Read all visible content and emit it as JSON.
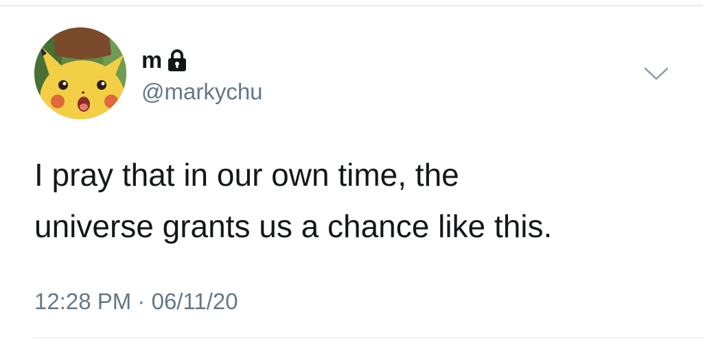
{
  "tweet": {
    "author": {
      "display_name": "m",
      "handle": "@markychu",
      "protected": true,
      "avatar_icon": "surprised-pikachu-avatar"
    },
    "text_lines": [
      "I pray that in our own time, the",
      "universe grants us a chance like this."
    ],
    "time": "12:28 PM",
    "separator": "·",
    "date": "06/11/20",
    "menu_icon": "chevron-down-icon"
  },
  "colors": {
    "text_primary": "#14171a",
    "text_secondary": "#657786",
    "divider": "#e1e8ed"
  }
}
